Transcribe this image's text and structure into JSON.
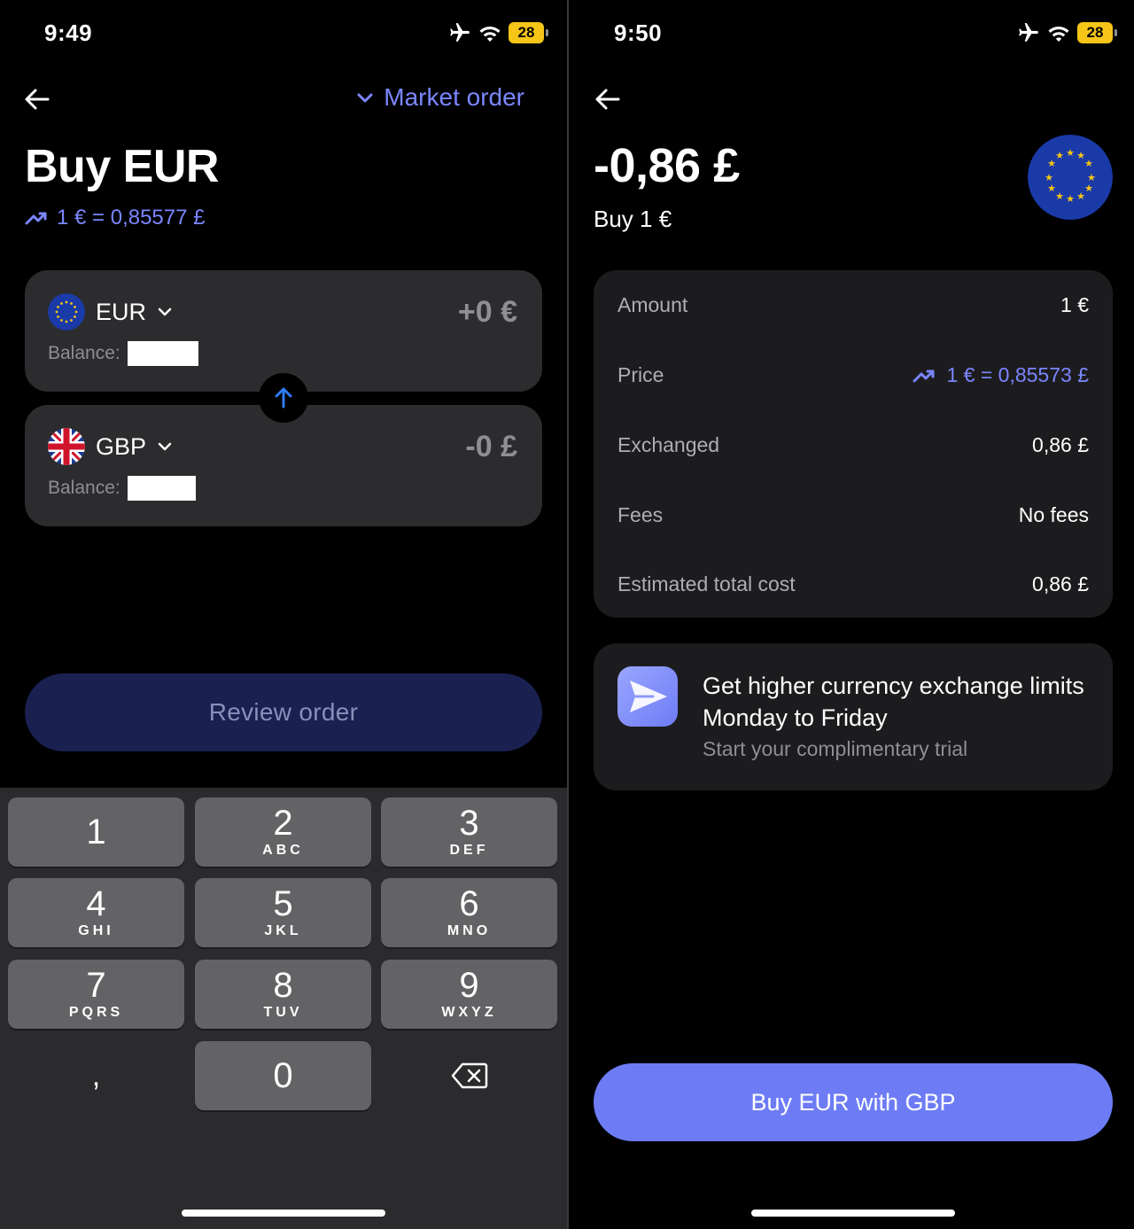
{
  "left": {
    "status": {
      "time": "9:49",
      "battery": "28"
    },
    "order_type": "Market order",
    "title": "Buy EUR",
    "rate": "1 € = 0,85577 £",
    "from": {
      "code": "EUR",
      "amount": "+0 €",
      "balance_label": "Balance:"
    },
    "to": {
      "code": "GBP",
      "amount": "-0 £",
      "balance_label": "Balance:"
    },
    "review_button": "Review order",
    "keypad": [
      {
        "digit": "1",
        "letters": ""
      },
      {
        "digit": "2",
        "letters": "ABC"
      },
      {
        "digit": "3",
        "letters": "DEF"
      },
      {
        "digit": "4",
        "letters": "GHI"
      },
      {
        "digit": "5",
        "letters": "JKL"
      },
      {
        "digit": "6",
        "letters": "MNO"
      },
      {
        "digit": "7",
        "letters": "PQRS"
      },
      {
        "digit": "8",
        "letters": "TUV"
      },
      {
        "digit": "9",
        "letters": "WXYZ"
      },
      {
        "digit": ",",
        "letters": ""
      },
      {
        "digit": "0",
        "letters": ""
      }
    ]
  },
  "right": {
    "status": {
      "time": "9:50",
      "battery": "28"
    },
    "total": "-0,86 £",
    "subtitle": "Buy 1 €",
    "details": [
      {
        "label": "Amount",
        "value": "1 €"
      },
      {
        "label": "Price",
        "value": "1 € = 0,85573 £"
      },
      {
        "label": "Exchanged",
        "value": "0,86 £"
      },
      {
        "label": "Fees",
        "value": "No fees"
      },
      {
        "label": "Estimated total cost",
        "value": "0,86 £"
      }
    ],
    "promo": {
      "title": "Get higher currency exchange limits Monday to Friday",
      "subtitle": "Start your complimentary trial"
    },
    "buy_button": "Buy EUR with GBP"
  },
  "colors": {
    "accent": "#7b86ff",
    "primary_button": "#6d7cf5",
    "card": "#2c2c2e",
    "battery": "#f5c518"
  },
  "icons": [
    "airplane-icon",
    "wifi-icon",
    "battery-icon",
    "back-arrow-icon",
    "chevron-down-icon",
    "trend-up-icon",
    "eu-flag-icon",
    "uk-flag-icon",
    "arrow-up-icon",
    "backspace-icon",
    "send-icon"
  ]
}
